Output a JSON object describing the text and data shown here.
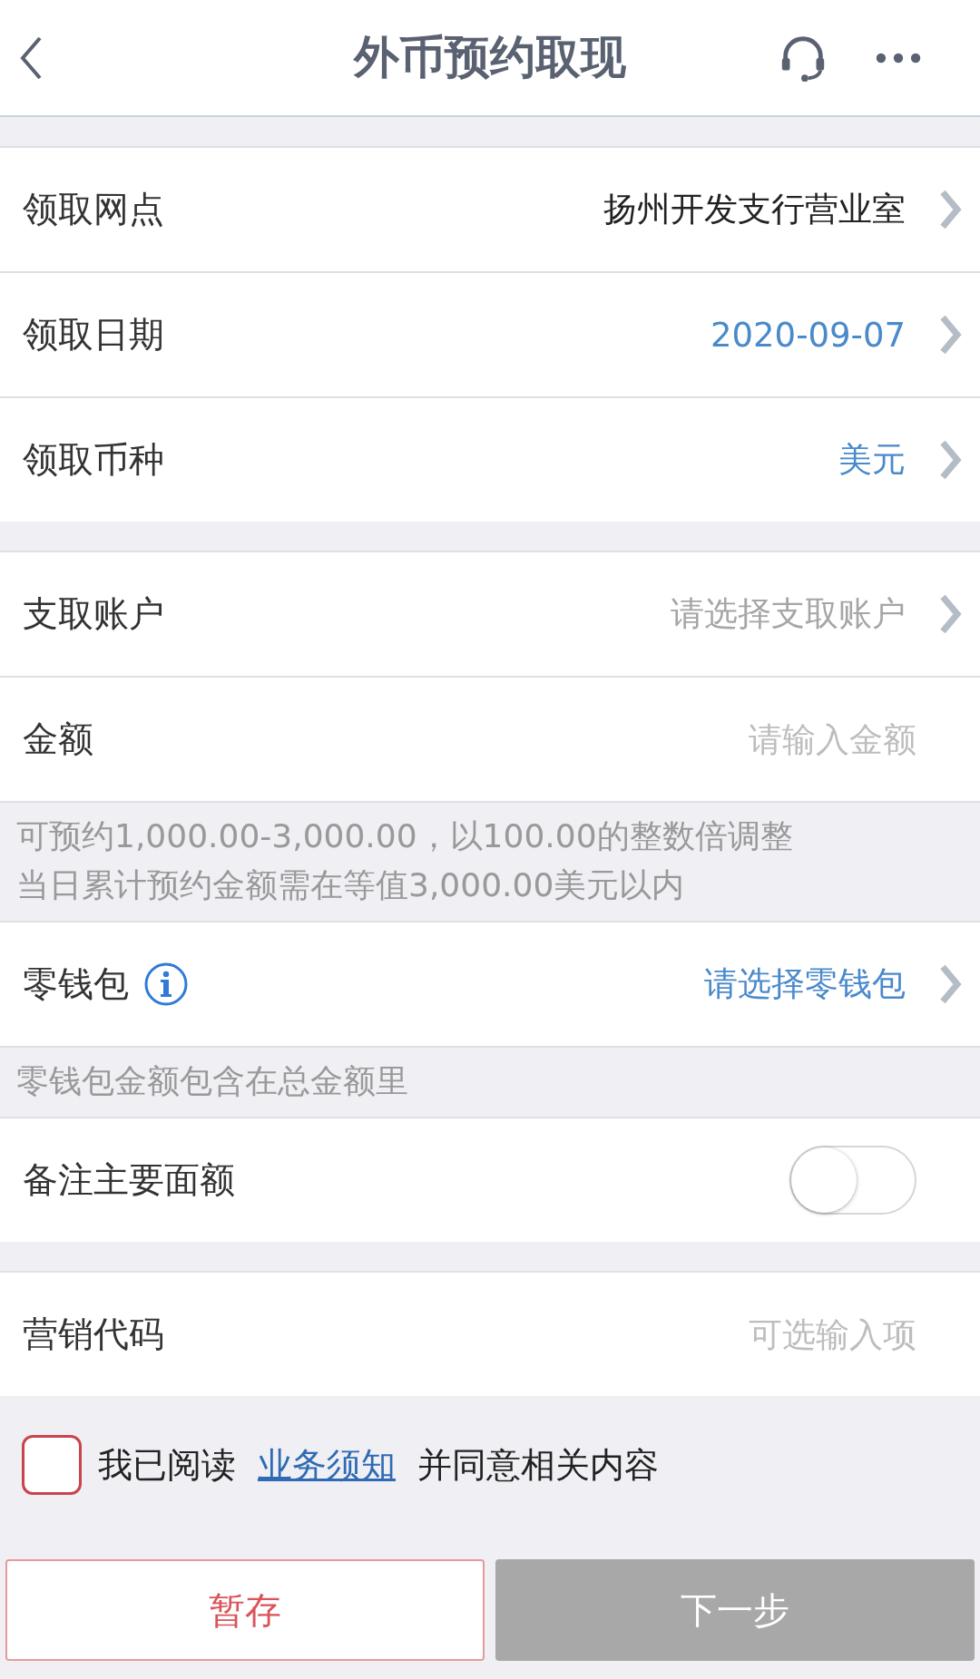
{
  "header": {
    "title": "外币预约取现"
  },
  "groups": [
    {
      "rows": [
        {
          "kind": "select",
          "label": "领取网点",
          "value": "扬州开发支行营业室",
          "color": "#222222"
        },
        {
          "kind": "select",
          "label": "领取日期",
          "value": "2020-09-07",
          "color": "#4a8acb"
        },
        {
          "kind": "select",
          "label": "领取币种",
          "value": "美元",
          "color": "#4a8acb"
        }
      ]
    },
    {
      "rows": [
        {
          "kind": "select",
          "label": "支取账户",
          "placeholder": "请选择支取账户"
        },
        {
          "kind": "input",
          "label": "金额",
          "placeholder": "请输入金额"
        },
        {
          "kind": "note",
          "lines": [
            "可预约1,000.00-3,000.00，以100.00的整数倍调整",
            "当日累计预约金额需在等值3,000.00美元以内"
          ]
        },
        {
          "kind": "select",
          "label": "零钱包",
          "info": true,
          "value": "请选择零钱包",
          "color": "#4a8acb"
        },
        {
          "kind": "note",
          "lines": [
            "零钱包金额包含在总金额里"
          ]
        },
        {
          "kind": "toggle",
          "label": "备注主要面额",
          "on": false
        }
      ]
    },
    {
      "rows": [
        {
          "kind": "input",
          "label": "营销代码",
          "placeholder": "可选输入项"
        }
      ]
    }
  ],
  "agreement": {
    "checked": false,
    "before": "我已阅读",
    "link": "业务须知",
    "after": "并同意相关内容"
  },
  "buttons": [
    {
      "label": "暂存",
      "disabled": false
    },
    {
      "label": "下一步",
      "disabled": true
    }
  ]
}
